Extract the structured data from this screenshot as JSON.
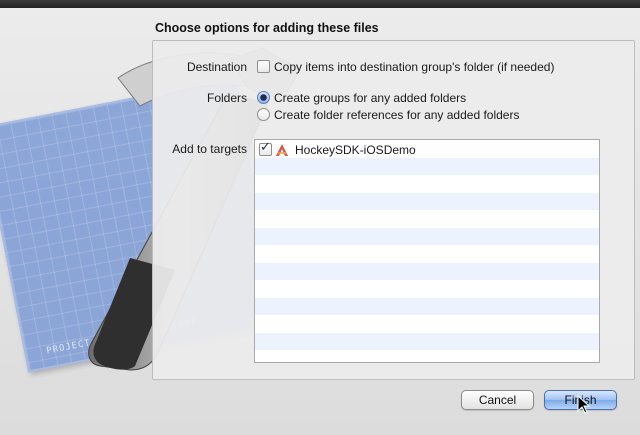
{
  "dialog": {
    "title": "Choose options for adding these files"
  },
  "destination": {
    "label": "Destination",
    "checkbox_label": "Copy items into destination group's folder (if needed)",
    "checked": false
  },
  "folders": {
    "label": "Folders",
    "options": [
      {
        "label": "Create groups for any added folders",
        "selected": true
      },
      {
        "label": "Create folder references for any added folders",
        "selected": false
      }
    ]
  },
  "targets": {
    "label": "Add to targets",
    "items": [
      {
        "name": "HockeySDK-iOSDemo",
        "checked": true,
        "icon": "app-target-icon"
      }
    ]
  },
  "buttons": {
    "cancel": "Cancel",
    "finish": "Finish"
  },
  "backdrop": {
    "blueprint_caption": "PROJECT: APPLICATION.APP"
  },
  "colors": {
    "accent": "#7eaae9",
    "list_stripe": "#edf3fe",
    "blueprint": "#7d9bd6"
  }
}
